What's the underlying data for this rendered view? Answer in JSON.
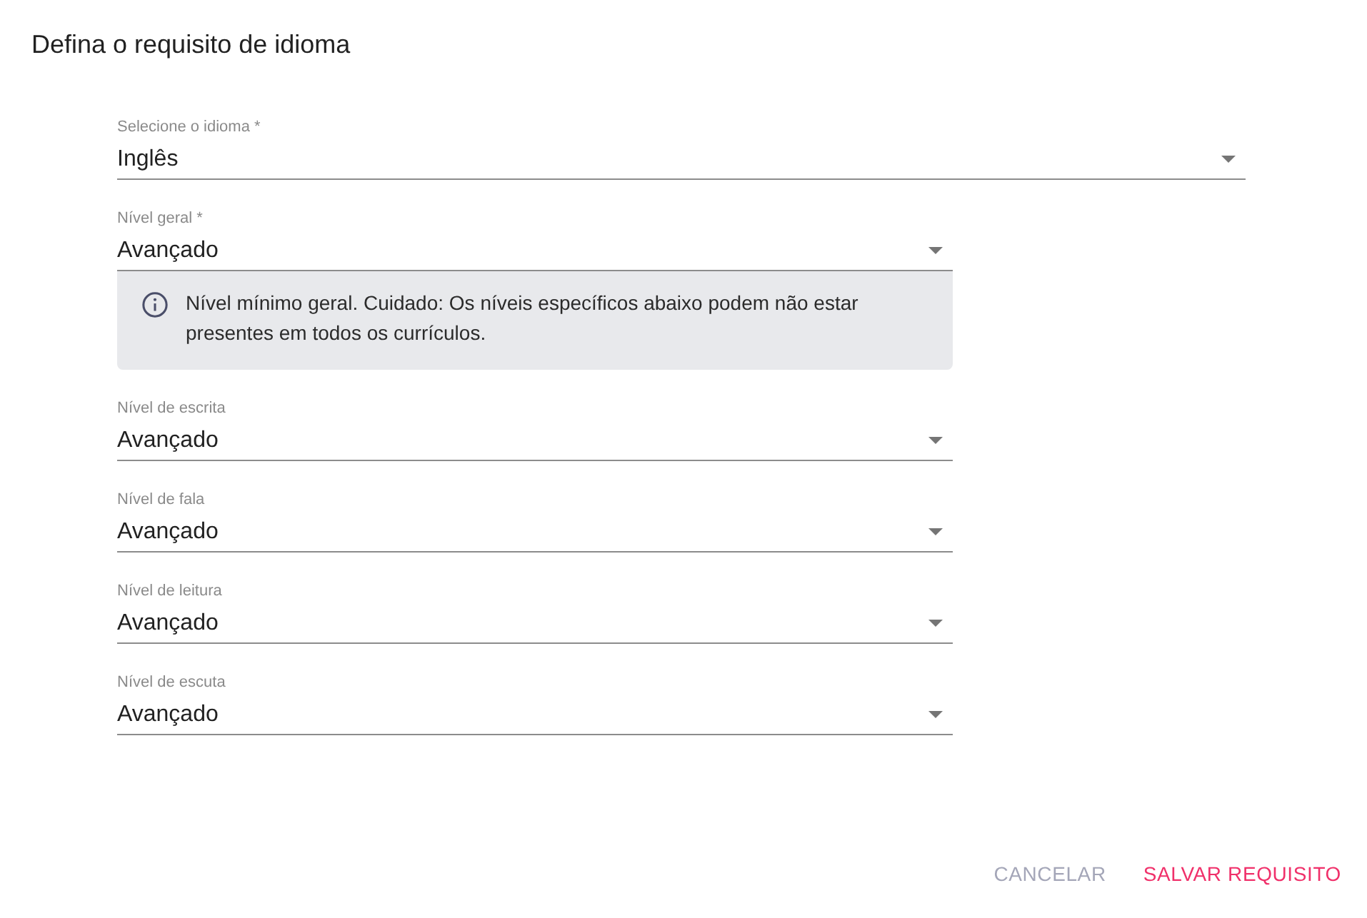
{
  "dialog": {
    "title": "Defina o requisito de idioma"
  },
  "language_field": {
    "label": "Selecione o idioma *",
    "value": "Inglês"
  },
  "overall_level_field": {
    "label": "Nível geral *",
    "value": "Avançado"
  },
  "info_note": {
    "text": "Nível mínimo geral. Cuidado: Os níveis específicos abaixo podem não estar presentes em todos os currículos."
  },
  "skill_fields": [
    {
      "label": "Nível de escrita",
      "value": "Avançado"
    },
    {
      "label": "Nível de fala",
      "value": "Avançado"
    },
    {
      "label": "Nível de leitura",
      "value": "Avançado"
    },
    {
      "label": "Nível de escuta",
      "value": "Avançado"
    }
  ],
  "buttons": [
    {
      "label": "CANCELAR",
      "disabled": true
    },
    {
      "label": "SALVAR REQUISITO",
      "disabled": false
    }
  ]
}
